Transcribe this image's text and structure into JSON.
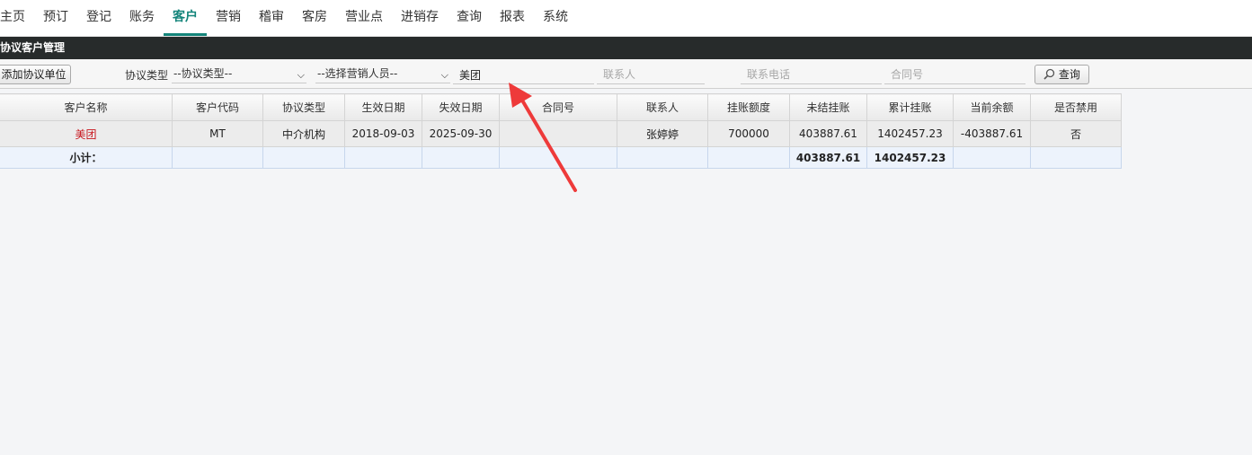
{
  "nav": {
    "items": [
      "主页",
      "预订",
      "登记",
      "账务",
      "客户",
      "营销",
      "稽审",
      "客房",
      "营业点",
      "进销存",
      "查询",
      "报表",
      "系统"
    ],
    "active_index": 4,
    "accent_color": "#14857a"
  },
  "title": "协议客户管理",
  "filters": {
    "add_button": "添加协议单位",
    "type_label": "协议类型",
    "type_select": "--协议类型--",
    "sales_select": "--选择营销人员--",
    "name_value": "美团",
    "contact_placeholder": "联系人",
    "phone_placeholder": "联系电话",
    "contract_placeholder": "合同号",
    "search_button": "查询",
    "search_icon": "magnifier-icon"
  },
  "table": {
    "headers": [
      "客户名称",
      "客户代码",
      "协议类型",
      "生效日期",
      "失效日期",
      "合同号",
      "联系人",
      "挂账额度",
      "未结挂账",
      "累计挂账",
      "当前余额",
      "是否禁用"
    ],
    "rows": [
      [
        "美团",
        "MT",
        "中介机构",
        "2018-09-03",
        "2025-09-30",
        "",
        "张婷婷",
        "700000",
        "403887.61",
        "1402457.23",
        "-403887.61",
        "否"
      ]
    ],
    "subtotal": {
      "label": "小计：",
      "unsettled": "403887.61",
      "cumulative": "1402457.23"
    }
  },
  "annotation": {
    "color": "#ee3a3a"
  }
}
